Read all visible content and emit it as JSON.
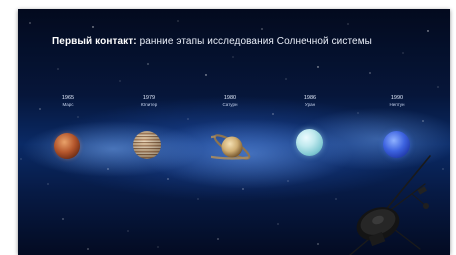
{
  "slide": {
    "title_bold": "Первый контакт:",
    "title_rest": " ранние этапы исследования Солнечной системы"
  },
  "timeline": [
    {
      "year": "1965",
      "name": "Марс"
    },
    {
      "year": "1979",
      "name": "Юпитер"
    },
    {
      "year": "1980",
      "name": "Сатурн"
    },
    {
      "year": "1986",
      "name": "Уран"
    },
    {
      "year": "1990",
      "name": "Нептун"
    }
  ]
}
